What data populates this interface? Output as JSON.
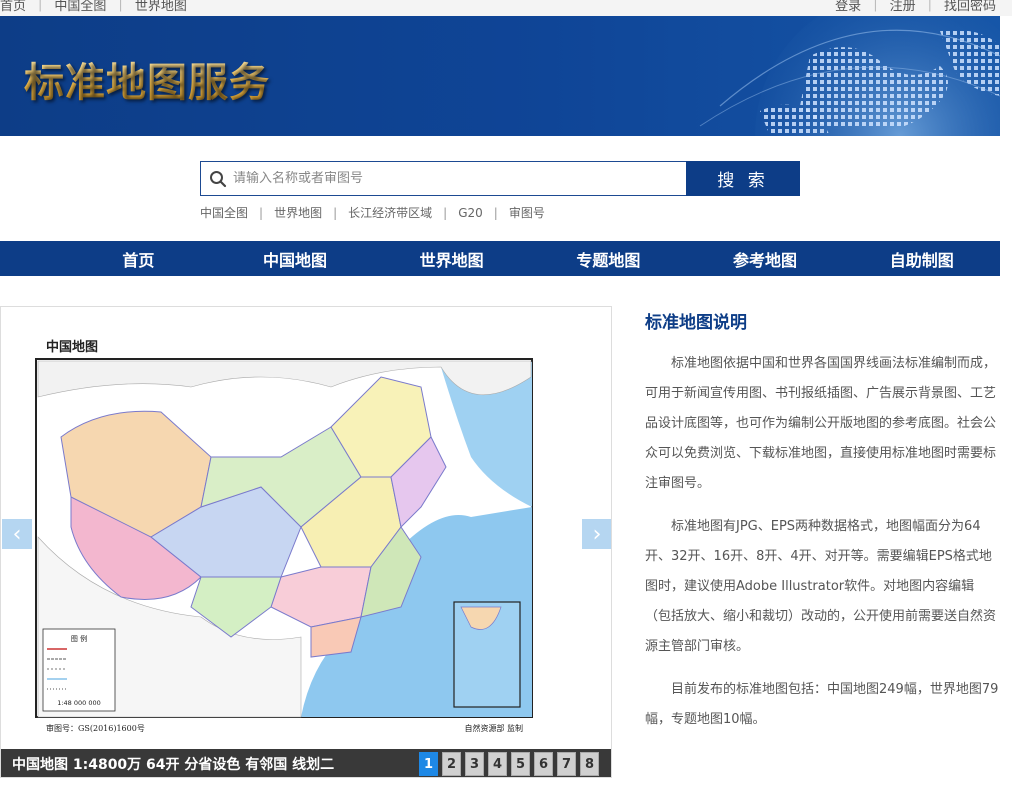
{
  "topbar": {
    "left_links": [
      "首页",
      "中国全图",
      "世界地图"
    ],
    "right_links": [
      "登录",
      "注册",
      "找回密码"
    ]
  },
  "banner": {
    "title": "标准地图服务"
  },
  "search": {
    "placeholder": "请输入名称或者审图号",
    "button_label": "搜 索",
    "quick_links": [
      "中国全图",
      "世界地图",
      "长江经济带区域",
      "G20",
      "审图号"
    ]
  },
  "nav": {
    "items": [
      "首页",
      "中国地图",
      "世界地图",
      "专题地图",
      "参考地图",
      "自助制图"
    ]
  },
  "slider": {
    "map_title": "中国地图",
    "map_approval": "审图号：GS(2016)1600号",
    "map_supervisor": "自然资源部 监制",
    "legend_title": "图 例",
    "legend_scale": "1:48 000 000",
    "caption": "中国地图 1:4800万 64开 分省设色 有邻国 线划二",
    "pages": [
      "1",
      "2",
      "3",
      "4",
      "5",
      "6",
      "7",
      "8"
    ],
    "active_page": "1",
    "prev_arrow": "‹",
    "next_arrow": "›"
  },
  "description": {
    "title": "标准地图说明",
    "paragraphs": [
      "标准地图依据中国和世界各国国界线画法标准编制而成，可用于新闻宣传用图、书刊报纸插图、广告展示背景图、工艺品设计底图等，也可作为编制公开版地图的参考底图。社会公众可以免费浏览、下载标准地图，直接使用标准地图时需要标注审图号。",
      "标准地图有JPG、EPS两种数据格式，地图幅面分为64开、32开、16开、8开、4开、对开等。需要编辑EPS格式地图时，建议使用Adobe Illustrator软件。对地图内容编辑（包括放大、缩小和裁切）改动的，公开使用前需要送自然资源主管部门审核。",
      "目前发布的标准地图包括：中国地图249幅，世界地图79幅，专题地图10幅。"
    ]
  },
  "colors": {
    "brand_blue": "#0d3d87",
    "active_page": "#1e88e5",
    "title_gold": "#e8b64a"
  }
}
